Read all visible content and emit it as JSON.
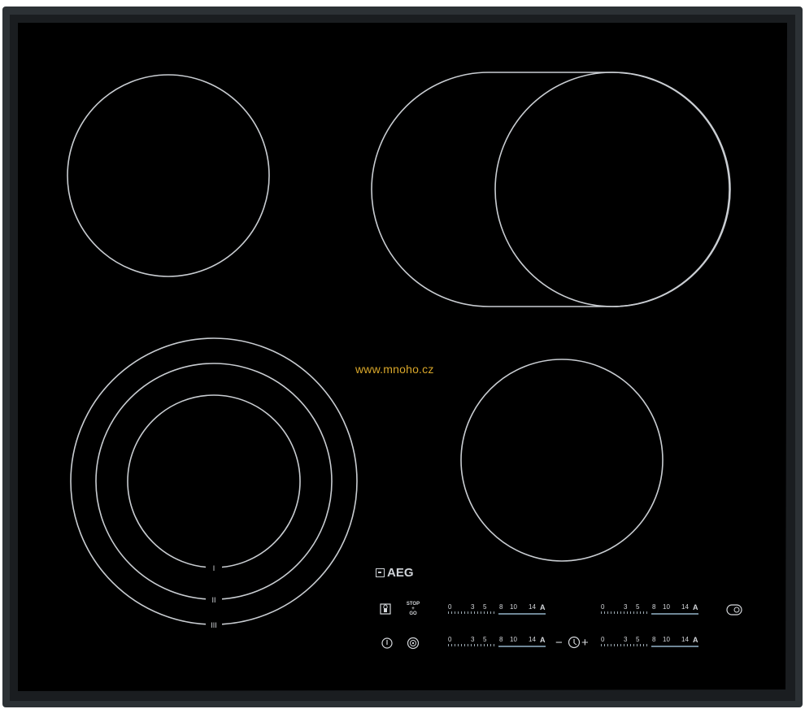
{
  "watermark": "www.mnoho.cz",
  "brand": {
    "name": "AEG"
  },
  "controls": {
    "stop_go": {
      "line1": "STOP",
      "line2": "+",
      "line3": "GO"
    },
    "timer_minus": "−",
    "timer_plus": "+",
    "scales": [
      {
        "labels": [
          "0",
          "3",
          "5",
          "8",
          "10",
          "14",
          "A"
        ]
      },
      {
        "labels": [
          "0",
          "3",
          "5",
          "8",
          "10",
          "14",
          "A"
        ]
      },
      {
        "labels": [
          "0",
          "3",
          "5",
          "8",
          "10",
          "14",
          "A"
        ]
      },
      {
        "labels": [
          "0",
          "3",
          "5",
          "8",
          "10",
          "14",
          "A"
        ]
      }
    ]
  },
  "zone_markers": [
    "I",
    "II",
    "III"
  ],
  "icons": {
    "lock": "lock-icon",
    "power": "power-icon",
    "bridge": "bridge-icon",
    "timer": "timer-icon",
    "dual_zone": "dual-zone-icon"
  },
  "colors": {
    "glass": "#000000",
    "frame": "#2a2f33",
    "zone_lines": "#c9cdd2",
    "watermark": "#d9a72a"
  }
}
